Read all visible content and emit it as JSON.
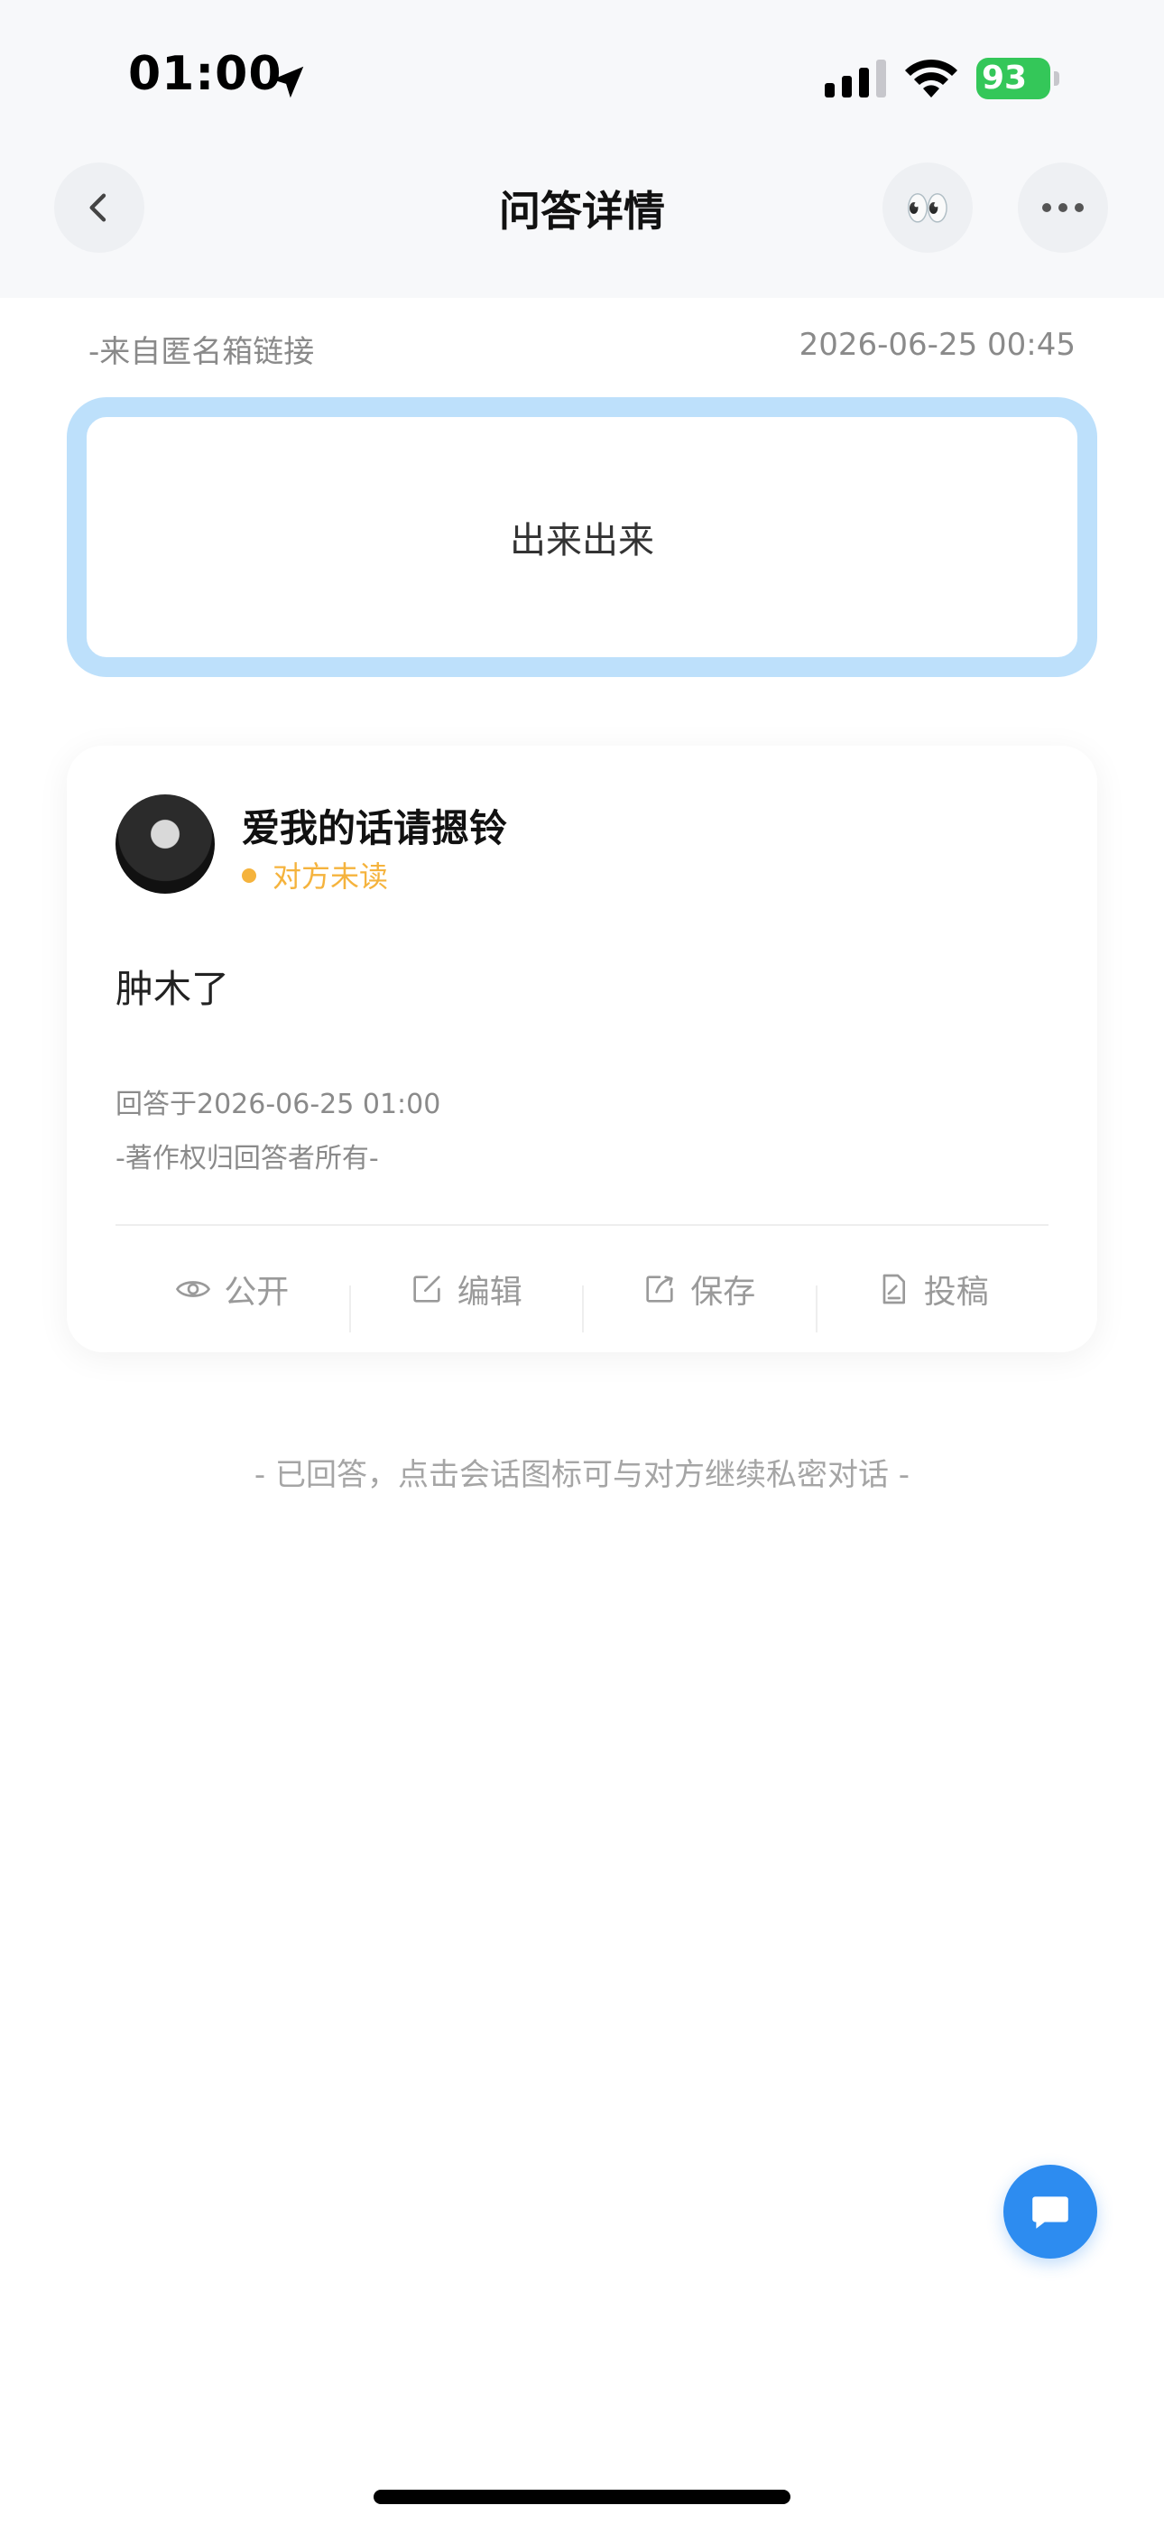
{
  "status_bar": {
    "time": "01:00",
    "battery_level": "93",
    "battery_color": "#34c759",
    "icons": [
      "location-arrow-icon",
      "cellular-signal-icon",
      "wifi-icon",
      "battery-charging-icon"
    ]
  },
  "nav": {
    "title": "问答详情",
    "back_icon": "chevron-left-icon",
    "eyes_emoji": "👀",
    "more_icon": "ellipsis-icon"
  },
  "question": {
    "source": "-来自匿名箱链接",
    "time": "2026-06-25 00:45",
    "text": "出来出来",
    "border_color": "#bde0fb"
  },
  "answer": {
    "user_name": "爱我的话请摁铃",
    "read_status": "对方未读",
    "status_color": "#f5b33d",
    "text": "肿木了",
    "answered_at": "回答于2026-06-25 01:00",
    "copyright": "-著作权归回答者所有-",
    "actions": [
      {
        "label": "公开",
        "icon": "eye-icon"
      },
      {
        "label": "编辑",
        "icon": "edit-icon"
      },
      {
        "label": "保存",
        "icon": "share-export-icon"
      },
      {
        "label": "投稿",
        "icon": "document-icon"
      }
    ]
  },
  "footer_note": "- 已回答，点击会话图标可与对方继续私密对话 -",
  "fab": {
    "icon": "chat-bubble-icon",
    "color": "#2d8cf0"
  }
}
